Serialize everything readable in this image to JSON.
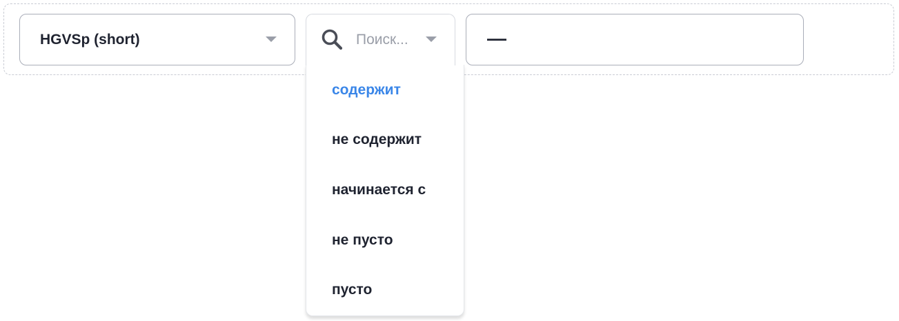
{
  "field_select": {
    "value": "HGVSp (short)"
  },
  "operator_select": {
    "placeholder": "Поиск..."
  },
  "value_input": {
    "value": "—"
  },
  "operator_options": [
    {
      "label": "содержит",
      "selected": true
    },
    {
      "label": "не содержит",
      "selected": false
    },
    {
      "label": "начинается с",
      "selected": false
    },
    {
      "label": "не пусто",
      "selected": false
    },
    {
      "label": "пусто",
      "selected": false
    }
  ],
  "colors": {
    "accent": "#3a86e8",
    "text": "#1f2330",
    "muted": "#9a9ea8",
    "border": "#a9adb8"
  },
  "icons": {
    "search": "search-icon",
    "caret": "caret-down-icon"
  }
}
